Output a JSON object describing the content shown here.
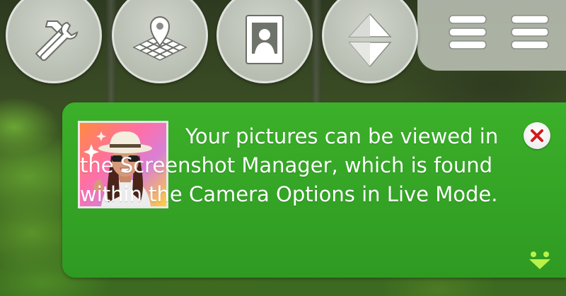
{
  "toolbar": {
    "buttons": [
      {
        "icon": "build-tools-icon"
      },
      {
        "icon": "map-pin-grid-icon"
      },
      {
        "icon": "portrait-frame-icon"
      },
      {
        "icon": "up-down-arrows-icon"
      }
    ],
    "menus": [
      {
        "icon": "menu-icon"
      },
      {
        "icon": "menu-icon"
      }
    ]
  },
  "notification": {
    "message": "Your pictures can be viewed in the Screenshot Manager, which is found within the Camera Options in Live Mode.",
    "close_icon": "close-icon",
    "expand_icon": "expand-down-icon",
    "accent": "#35a626"
  }
}
